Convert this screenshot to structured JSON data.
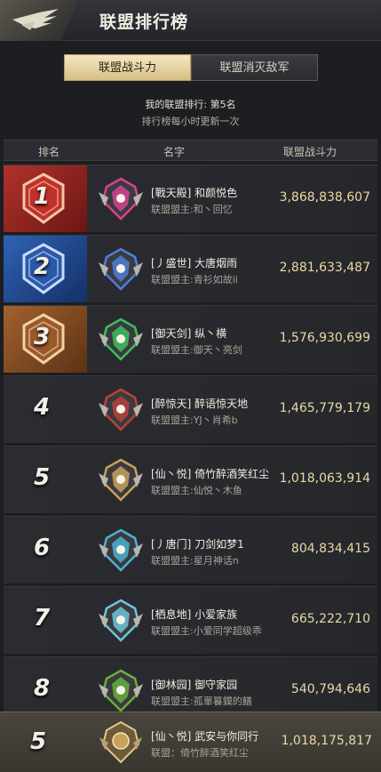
{
  "header": {
    "title": "联盟排行榜",
    "logo_icon": "winged-emblem-icon"
  },
  "tabs": [
    {
      "label": "联盟战斗力",
      "active": true
    },
    {
      "label": "联盟消灭敌军",
      "active": false
    }
  ],
  "summary": {
    "my_rank": "我的联盟排行: 第5名",
    "update_note": "排行榜每小时更新一次"
  },
  "columns": {
    "rank": "排名",
    "name": "名字",
    "power": "联盟战斗力"
  },
  "rows": [
    {
      "rank": "1",
      "name": "[戰天殿] 和颜悦色",
      "leader": "联盟盟主:和丶回忆",
      "power": "3,868,838,607",
      "emblem_color": "#d8438f"
    },
    {
      "rank": "2",
      "name": "[丿盛世] 大唐烟雨",
      "leader": "联盟盟主:青衫如故ii",
      "power": "2,881,633,487",
      "emblem_color": "#4f7fd8"
    },
    {
      "rank": "3",
      "name": "[御天剑] 纵丶横",
      "leader": "联盟盟主:御天丶亮剑",
      "power": "1,576,930,699",
      "emblem_color": "#3fbf5a"
    },
    {
      "rank": "4",
      "name": "[醉惊天] 醉语惊天地",
      "leader": "联盟盟主:YJ丶肖希b",
      "power": "1,465,779,179",
      "emblem_color": "#b8433a"
    },
    {
      "rank": "5",
      "name": "[仙丶悦] 倚竹醉酒笑红尘",
      "leader": "联盟盟主:仙悦丶木鱼",
      "power": "1,018,063,914",
      "emblem_color": "#c8a25a"
    },
    {
      "rank": "6",
      "name": "[丿唐门] 刀剑如梦1",
      "leader": "联盟盟主:星月神话n",
      "power": "804,834,415",
      "emblem_color": "#49b4d0"
    },
    {
      "rank": "7",
      "name": "[栖息地] 小爱家族",
      "leader": "联盟盟主:小爱同学超级乖",
      "power": "665,222,710",
      "emblem_color": "#6cc7d8"
    },
    {
      "rank": "8",
      "name": "[御林园] 御守家园",
      "leader": "联盟盟主:孤單籑鏌的饍",
      "power": "540,794,646",
      "emblem_color": "#66b03c"
    }
  ],
  "self_row": {
    "rank": "5",
    "name": "[仙丶悦] 武安与你同行",
    "leader": "联盟：倚竹醉酒笑红尘",
    "power": "1,018,175,817",
    "emblem_color": "#c8a25a"
  },
  "colors": {
    "accent_gold": "#e9d9a4",
    "tab_active": "#e6d3a2"
  }
}
